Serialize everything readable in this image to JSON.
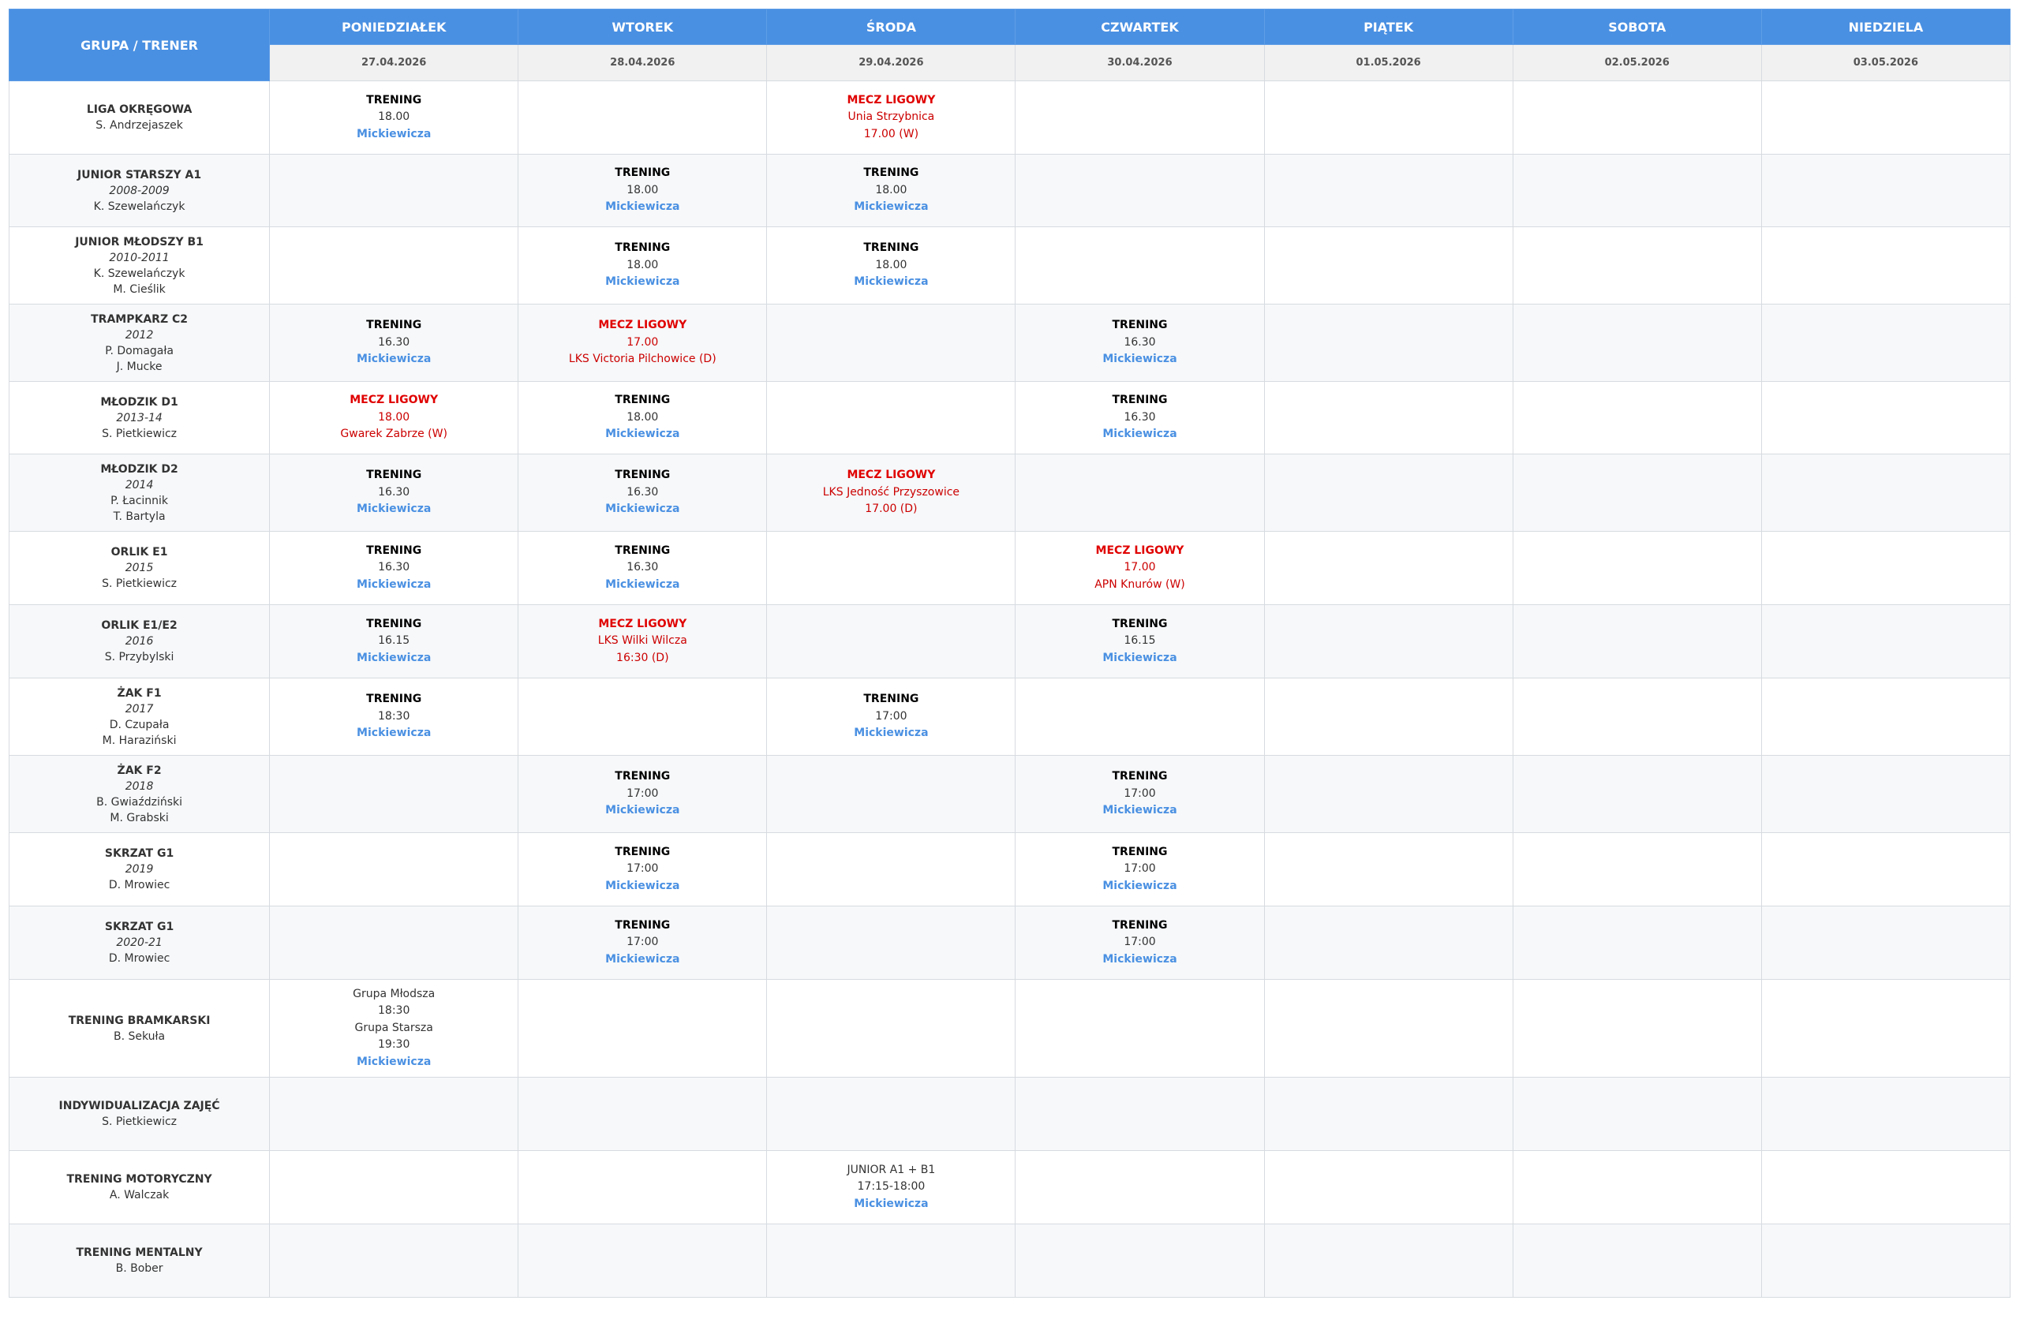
{
  "header": {
    "group_col": "GRUPA / TRENER",
    "days": [
      {
        "name": "PONIEDZIAŁEK",
        "date": "27.04.2026"
      },
      {
        "name": "WTOREK",
        "date": "28.04.2026"
      },
      {
        "name": "ŚRODA",
        "date": "29.04.2026"
      },
      {
        "name": "CZWARTEK",
        "date": "30.04.2026"
      },
      {
        "name": "PIĄTEK",
        "date": "01.05.2026"
      },
      {
        "name": "SOBOTA",
        "date": "02.05.2026"
      },
      {
        "name": "NIEDZIELA",
        "date": "03.05.2026"
      }
    ]
  },
  "colors": {
    "header_blue": "#4a90e2",
    "venue_blue": "#4a90e2",
    "match_red": "#e00000",
    "date_row_gray": "#f1f1f1"
  },
  "rows": [
    {
      "group": {
        "name": "LIGA OKRĘGOWA",
        "year": "",
        "coaches": [
          "S. Andrzejaszek"
        ]
      },
      "cells": [
        [
          {
            "t": "train",
            "v": "TRENING"
          },
          {
            "t": "time",
            "v": "18.00"
          },
          {
            "t": "venue",
            "v": "Mickiewicza"
          }
        ],
        [],
        [
          {
            "t": "match",
            "v": "MECZ LIGOWY"
          },
          {
            "t": "mline",
            "v": "Unia Strzybnica"
          },
          {
            "t": "mline",
            "v": "17.00 (W)"
          }
        ],
        [],
        [],
        [],
        []
      ]
    },
    {
      "group": {
        "name": "JUNIOR STARSZY A1",
        "year": "2008-2009",
        "coaches": [
          "K. Szewelańczyk"
        ]
      },
      "cells": [
        [],
        [
          {
            "t": "train",
            "v": "TRENING"
          },
          {
            "t": "time",
            "v": "18.00"
          },
          {
            "t": "venue",
            "v": "Mickiewicza"
          }
        ],
        [
          {
            "t": "train",
            "v": "TRENING"
          },
          {
            "t": "time",
            "v": "18.00"
          },
          {
            "t": "venue",
            "v": "Mickiewicza"
          }
        ],
        [],
        [],
        [],
        []
      ]
    },
    {
      "group": {
        "name": "JUNIOR MŁODSZY B1",
        "year": "2010-2011",
        "coaches": [
          "K. Szewelańczyk",
          "M. Cieślik"
        ]
      },
      "cells": [
        [],
        [
          {
            "t": "train",
            "v": "TRENING"
          },
          {
            "t": "time",
            "v": "18.00"
          },
          {
            "t": "venue",
            "v": "Mickiewicza"
          }
        ],
        [
          {
            "t": "train",
            "v": "TRENING"
          },
          {
            "t": "time",
            "v": "18.00"
          },
          {
            "t": "venue",
            "v": "Mickiewicza"
          }
        ],
        [],
        [],
        [],
        []
      ]
    },
    {
      "group": {
        "name": "TRAMPKARZ C2",
        "year": "2012",
        "coaches": [
          "P. Domagała",
          "J. Mucke"
        ]
      },
      "cells": [
        [
          {
            "t": "train",
            "v": "TRENING"
          },
          {
            "t": "time",
            "v": "16.30"
          },
          {
            "t": "venue",
            "v": "Mickiewicza"
          }
        ],
        [
          {
            "t": "match",
            "v": "MECZ LIGOWY"
          },
          {
            "t": "mline",
            "v": "17.00"
          },
          {
            "t": "mline",
            "v": "LKS Victoria Pilchowice (D)"
          }
        ],
        [],
        [
          {
            "t": "train",
            "v": "TRENING"
          },
          {
            "t": "time",
            "v": "16.30"
          },
          {
            "t": "venue",
            "v": "Mickiewicza"
          }
        ],
        [],
        [],
        []
      ]
    },
    {
      "group": {
        "name": "MŁODZIK D1",
        "year": "2013-14",
        "coaches": [
          "S. Pietkiewicz"
        ]
      },
      "cells": [
        [
          {
            "t": "match",
            "v": "MECZ LIGOWY"
          },
          {
            "t": "mline",
            "v": "18.00"
          },
          {
            "t": "mline",
            "v": "Gwarek Zabrze (W)"
          }
        ],
        [
          {
            "t": "train",
            "v": "TRENING"
          },
          {
            "t": "time",
            "v": "18.00"
          },
          {
            "t": "venue",
            "v": "Mickiewicza"
          }
        ],
        [],
        [
          {
            "t": "train",
            "v": "TRENING"
          },
          {
            "t": "time",
            "v": "16.30"
          },
          {
            "t": "venue",
            "v": "Mickiewicza"
          }
        ],
        [],
        [],
        []
      ]
    },
    {
      "group": {
        "name": "MŁODZIK D2",
        "year": "2014",
        "coaches": [
          "P. Łacinnik",
          "T. Bartyla"
        ]
      },
      "cells": [
        [
          {
            "t": "train",
            "v": "TRENING"
          },
          {
            "t": "time",
            "v": "16.30"
          },
          {
            "t": "venue",
            "v": "Mickiewicza"
          }
        ],
        [
          {
            "t": "train",
            "v": "TRENING"
          },
          {
            "t": "time",
            "v": "16.30"
          },
          {
            "t": "venue",
            "v": "Mickiewicza"
          }
        ],
        [
          {
            "t": "match",
            "v": "MECZ LIGOWY"
          },
          {
            "t": "mline",
            "v": "LKS Jedność Przyszowice"
          },
          {
            "t": "mline",
            "v": "17.00 (D)"
          }
        ],
        [],
        [],
        [],
        []
      ]
    },
    {
      "group": {
        "name": "ORLIK E1",
        "year": "2015",
        "coaches": [
          "S. Pietkiewicz"
        ]
      },
      "cells": [
        [
          {
            "t": "train",
            "v": "TRENING"
          },
          {
            "t": "time",
            "v": "16.30"
          },
          {
            "t": "venue",
            "v": "Mickiewicza"
          }
        ],
        [
          {
            "t": "train",
            "v": "TRENING"
          },
          {
            "t": "time",
            "v": "16.30"
          },
          {
            "t": "venue",
            "v": "Mickiewicza"
          }
        ],
        [],
        [
          {
            "t": "match",
            "v": "MECZ LIGOWY"
          },
          {
            "t": "mline",
            "v": "17.00"
          },
          {
            "t": "mline",
            "v": "APN Knurów (W)"
          }
        ],
        [],
        [],
        []
      ]
    },
    {
      "group": {
        "name": "ORLIK E1/E2",
        "year": "2016",
        "coaches": [
          "S. Przybylski"
        ]
      },
      "cells": [
        [
          {
            "t": "train",
            "v": "TRENING"
          },
          {
            "t": "time",
            "v": "16.15"
          },
          {
            "t": "venue",
            "v": "Mickiewicza"
          }
        ],
        [
          {
            "t": "match",
            "v": "MECZ LIGOWY"
          },
          {
            "t": "mline",
            "v": "LKS Wilki Wilcza"
          },
          {
            "t": "mline",
            "v": "16:30 (D)"
          }
        ],
        [],
        [
          {
            "t": "train",
            "v": "TRENING"
          },
          {
            "t": "time",
            "v": "16.15"
          },
          {
            "t": "venue",
            "v": "Mickiewicza"
          }
        ],
        [],
        [],
        []
      ]
    },
    {
      "group": {
        "name": "ŻAK F1",
        "year": "2017",
        "coaches": [
          "D. Czupała",
          "M. Haraziński"
        ]
      },
      "cells": [
        [
          {
            "t": "train",
            "v": "TRENING"
          },
          {
            "t": "time",
            "v": "18:30"
          },
          {
            "t": "venue",
            "v": "Mickiewicza"
          }
        ],
        [],
        [
          {
            "t": "train",
            "v": "TRENING"
          },
          {
            "t": "time",
            "v": "17:00"
          },
          {
            "t": "venue",
            "v": "Mickiewicza"
          }
        ],
        [],
        [],
        [],
        []
      ]
    },
    {
      "group": {
        "name": "ŻAK F2",
        "year": "2018",
        "coaches": [
          "B. Gwiaździński",
          "M. Grabski"
        ]
      },
      "cells": [
        [],
        [
          {
            "t": "train",
            "v": "TRENING"
          },
          {
            "t": "time",
            "v": "17:00"
          },
          {
            "t": "venue",
            "v": "Mickiewicza"
          }
        ],
        [],
        [
          {
            "t": "train",
            "v": "TRENING"
          },
          {
            "t": "time",
            "v": "17:00"
          },
          {
            "t": "venue",
            "v": "Mickiewicza"
          }
        ],
        [],
        [],
        []
      ]
    },
    {
      "group": {
        "name": "SKRZAT G1",
        "year": "2019",
        "coaches": [
          "D. Mrowiec"
        ]
      },
      "cells": [
        [],
        [
          {
            "t": "train",
            "v": "TRENING"
          },
          {
            "t": "time",
            "v": "17:00"
          },
          {
            "t": "venue",
            "v": "Mickiewicza"
          }
        ],
        [],
        [
          {
            "t": "train",
            "v": "TRENING"
          },
          {
            "t": "time",
            "v": "17:00"
          },
          {
            "t": "venue",
            "v": "Mickiewicza"
          }
        ],
        [],
        [],
        []
      ]
    },
    {
      "group": {
        "name": "SKRZAT G1",
        "year": "2020-21",
        "coaches": [
          "D. Mrowiec"
        ]
      },
      "cells": [
        [],
        [
          {
            "t": "train",
            "v": "TRENING"
          },
          {
            "t": "time",
            "v": "17:00"
          },
          {
            "t": "venue",
            "v": "Mickiewicza"
          }
        ],
        [],
        [
          {
            "t": "train",
            "v": "TRENING"
          },
          {
            "t": "time",
            "v": "17:00"
          },
          {
            "t": "venue",
            "v": "Mickiewicza"
          }
        ],
        [],
        [],
        []
      ]
    },
    {
      "group": {
        "name": "TRENING BRAMKARSKI",
        "year": "",
        "coaches": [
          "B. Sekuła"
        ]
      },
      "cells": [
        [
          {
            "t": "plain",
            "v": "Grupa Młodsza"
          },
          {
            "t": "plain",
            "v": "18:30"
          },
          {
            "t": "plain",
            "v": "Grupa Starsza"
          },
          {
            "t": "plain",
            "v": "19:30"
          },
          {
            "t": "venue",
            "v": "Mickiewicza"
          }
        ],
        [],
        [],
        [],
        [],
        [],
        []
      ]
    },
    {
      "group": {
        "name": "INDYWIDUALIZACJA ZAJĘĆ",
        "year": "",
        "coaches": [
          "S. Pietkiewicz"
        ]
      },
      "cells": [
        [],
        [],
        [],
        [],
        [],
        [],
        []
      ]
    },
    {
      "group": {
        "name": "TRENING MOTORYCZNY",
        "year": "",
        "coaches": [
          "A. Walczak"
        ]
      },
      "cells": [
        [],
        [],
        [
          {
            "t": "plain",
            "v": "JUNIOR A1 + B1"
          },
          {
            "t": "plain",
            "v": "17:15-18:00"
          },
          {
            "t": "venue",
            "v": "Mickiewicza"
          }
        ],
        [],
        [],
        [],
        []
      ]
    },
    {
      "group": {
        "name": "TRENING MENTALNY",
        "year": "",
        "coaches": [
          "B. Bober"
        ]
      },
      "cells": [
        [],
        [],
        [],
        [],
        [],
        [],
        []
      ]
    }
  ]
}
